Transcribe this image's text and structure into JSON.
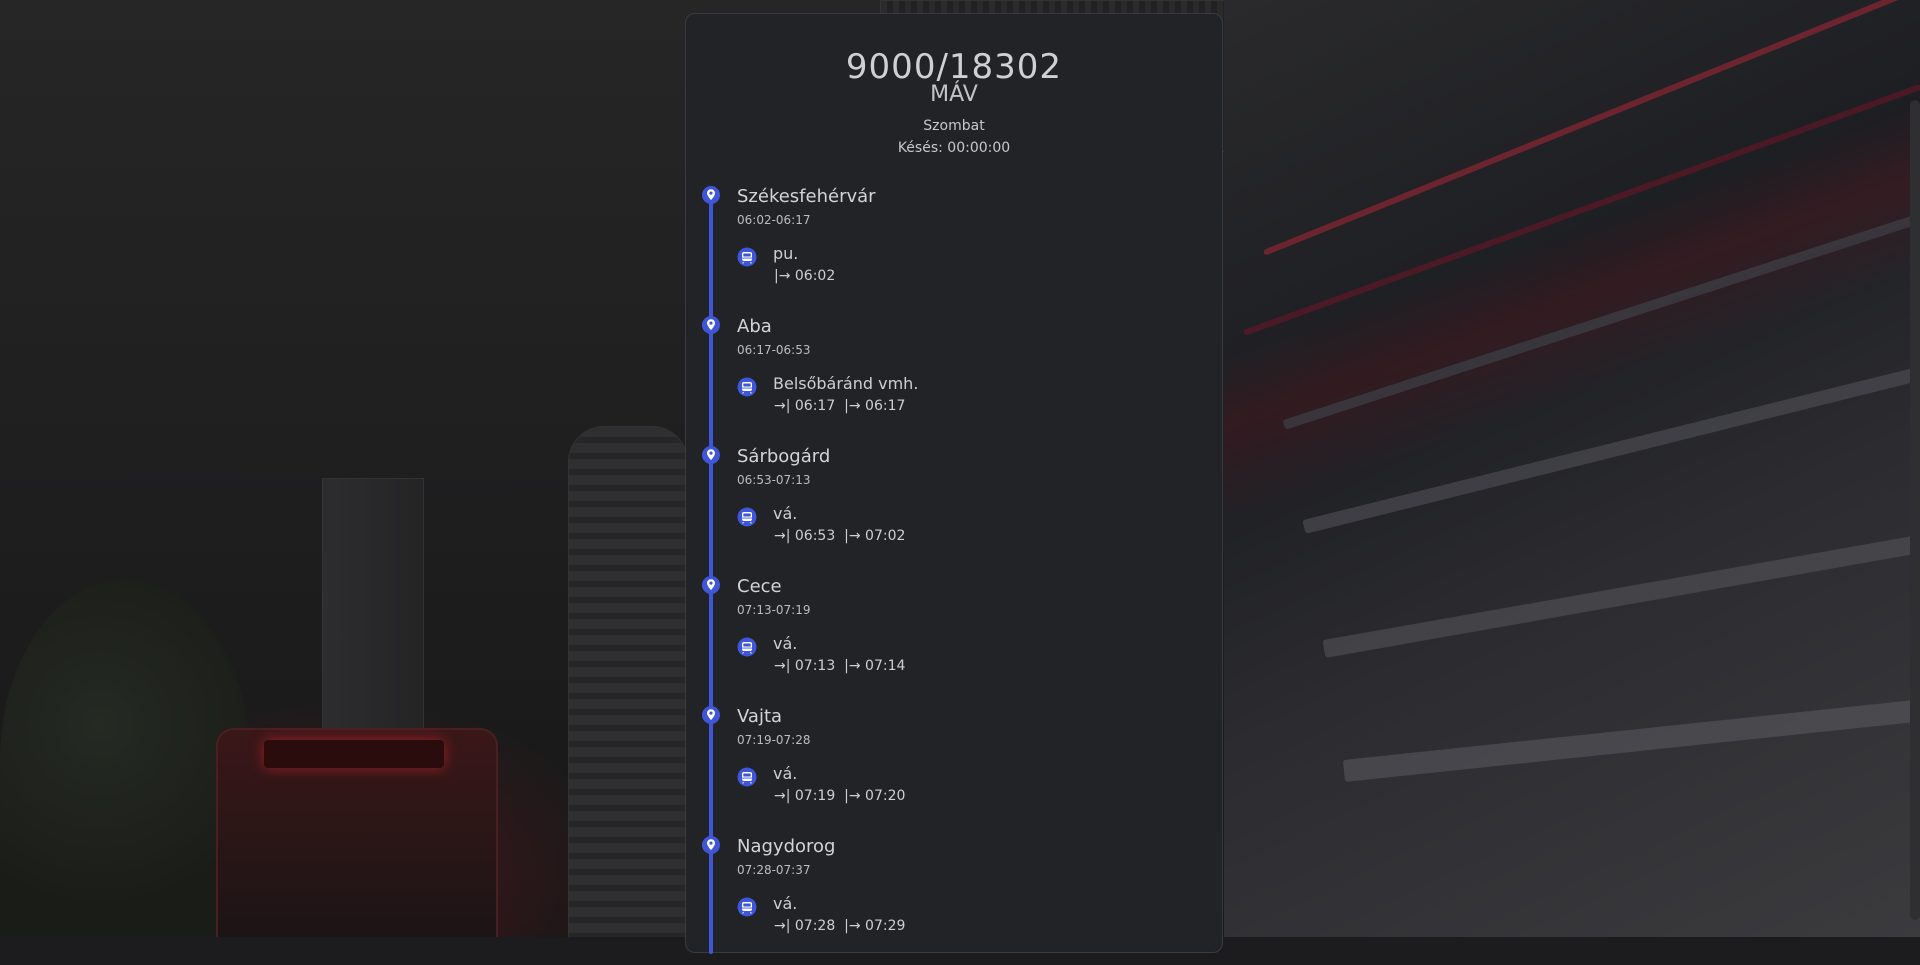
{
  "train": {
    "number": "9000/18302",
    "operator": "MÁV",
    "day": "Szombat",
    "delay": "Késés: 00:00:00"
  },
  "stops": [
    {
      "name": "Székesfehérvár",
      "time": "06:02-06:17",
      "platform": "pu.",
      "times": "|→ 06:02",
      "icon": "map-pin-icon"
    },
    {
      "name": "Aba",
      "time": "06:17-06:53",
      "platform": "Belsőbáránd vmh.",
      "times": "→| 06:17  |→ 06:17",
      "icon": "map-pin-icon"
    },
    {
      "name": "Sárbogárd",
      "time": "06:53-07:13",
      "platform": "vá.",
      "times": "→| 06:53  |→ 07:02",
      "icon": "map-pin-icon"
    },
    {
      "name": "Cece",
      "time": "07:13-07:19",
      "platform": "vá.",
      "times": "→| 07:13  |→ 07:14",
      "icon": "map-pin-icon"
    },
    {
      "name": "Vajta",
      "time": "07:19-07:28",
      "platform": "vá.",
      "times": "→| 07:19  |→ 07:20",
      "icon": "map-pin-icon"
    },
    {
      "name": "Nagydorog",
      "time": "07:28-07:37",
      "platform": "vá.",
      "times": "→| 07:28  |→ 07:29",
      "icon": "map-pin-icon"
    }
  ],
  "colors": {
    "accent": "#3f56d9",
    "card_bg": "#222326",
    "text": "#c8c8ca"
  }
}
